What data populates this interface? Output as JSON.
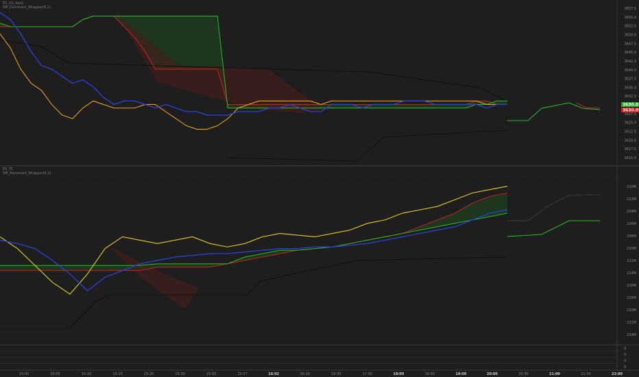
{
  "top_pane": {
    "title_line1": "ES_US_daily",
    "title_line2": "SM_Dominant_Wrapper(6,1)",
    "price_badges": [
      {
        "value": "3630.0",
        "color": "#1faa1f"
      },
      {
        "value": "3630.0",
        "color": "#e01010"
      }
    ]
  },
  "bottom_pane": {
    "title_line1": "ES_TC",
    "title_line2": "SM_Advanced_Wrapper(6,1)"
  },
  "colors": {
    "background": "#1e1e1e",
    "conversion_line": "#2b3fd1",
    "base_line": "#e6a020",
    "span_a": "#22c422",
    "span_b": "#cc2222",
    "lagging_span": "#111111",
    "cloud_bull": "#1d4a1d",
    "cloud_bear": "#4a1d1d"
  },
  "chart_data": [
    {
      "type": "line",
      "pane": "top",
      "y_ticks": [
        "3657.5",
        "3655.0",
        "3652.5",
        "3650.0",
        "3647.5",
        "3645.0",
        "3642.5",
        "3640.0",
        "3637.5",
        "3635.0",
        "3632.5",
        "3630.0",
        "3627.5",
        "3625.0",
        "3622.5",
        "3620.0",
        "3617.5",
        "3615.0"
      ],
      "ylim": [
        3614,
        3658
      ],
      "series": [
        {
          "role": "conversion",
          "values": [
            3656,
            3654,
            3650,
            3645,
            3641,
            3640,
            3638,
            3636,
            3637,
            3635,
            3632,
            3630,
            3631,
            3631,
            3630,
            3629,
            3630,
            3629,
            3628,
            3628,
            3627,
            3627,
            3627,
            3628,
            3628,
            3628,
            3629,
            3629,
            3630,
            3629,
            3628,
            3628,
            3630,
            3630,
            3630,
            3629,
            3630,
            3630,
            3630,
            3631,
            3631,
            3631,
            3630,
            3630,
            3630,
            3630,
            3630,
            3629,
            3630,
            3630
          ]
        },
        {
          "role": "base",
          "values": [
            3650,
            3646,
            3640,
            3636,
            3634,
            3630,
            3627,
            3626,
            3629,
            3631,
            3630,
            3629,
            3629,
            3629,
            3630,
            3630,
            3628,
            3626,
            3624,
            3623,
            3623,
            3624,
            3626,
            3629,
            3630,
            3631,
            3631,
            3631,
            3631,
            3631,
            3631,
            3630,
            3631,
            3631,
            3631,
            3631,
            3631,
            3631,
            3631,
            3631,
            3631,
            3631,
            3631,
            3631,
            3631,
            3631,
            3631,
            3630,
            3630,
            3630
          ]
        },
        {
          "role": "span_a",
          "values": [
            3653,
            3652,
            3652,
            3652,
            3652,
            3652,
            3652,
            3652,
            3654,
            3655,
            3655,
            3655,
            3655,
            3655,
            3655,
            3655,
            3655,
            3655,
            3655,
            3655,
            3655,
            3655,
            3629,
            3629,
            3629,
            3629,
            3629,
            3629,
            3629,
            3629,
            3629,
            3629,
            3629,
            3629,
            3629,
            3629,
            3629,
            3629,
            3629,
            3629,
            3629,
            3629,
            3629,
            3629,
            3629,
            3629,
            3630,
            3630,
            3631,
            3631
          ]
        },
        {
          "role": "span_b",
          "values": [
            3652,
            3652,
            3652,
            3652,
            3652,
            3652,
            3652,
            3652,
            3654,
            3655,
            3655,
            3655,
            3652,
            3649,
            3645,
            3640,
            3640,
            3640,
            3640,
            3640,
            3640,
            3640,
            3630,
            3630,
            3630,
            3630,
            3630,
            3630,
            3630,
            3630,
            3630,
            3630,
            3630,
            3630,
            3630,
            3630,
            3630,
            3630,
            3630,
            3630,
            3630,
            3630,
            3630,
            3630,
            3630,
            3630,
            3631,
            3631,
            3630,
            3630
          ]
        }
      ]
    },
    {
      "type": "line",
      "pane": "bottom",
      "y_ticks": [
        "210M",
        "212M",
        "204M",
        "206M",
        "208M",
        "210M",
        "212M",
        "214M",
        "216M",
        "218M",
        "220M",
        "222M",
        "224M"
      ],
      "series": [
        {
          "role": "conversion",
          "values": [
            0.6,
            0.58,
            0.55,
            0.48,
            0.4,
            0.3,
            0.38,
            0.42,
            0.46,
            0.48,
            0.5,
            0.51,
            0.52,
            0.52,
            0.53,
            0.54,
            0.55,
            0.55,
            0.56,
            0.56,
            0.57,
            0.58,
            0.6,
            0.62,
            0.64,
            0.66,
            0.68,
            0.72,
            0.76,
            0.78
          ]
        },
        {
          "role": "base",
          "values": [
            0.62,
            0.55,
            0.45,
            0.35,
            0.28,
            0.4,
            0.55,
            0.62,
            0.6,
            0.58,
            0.6,
            0.62,
            0.58,
            0.56,
            0.58,
            0.62,
            0.64,
            0.63,
            0.62,
            0.64,
            0.66,
            0.7,
            0.72,
            0.76,
            0.78,
            0.8,
            0.84,
            0.88,
            0.9,
            0.92
          ]
        },
        {
          "role": "span_a",
          "values": [
            0.45,
            0.45,
            0.45,
            0.45,
            0.45,
            0.45,
            0.45,
            0.45,
            0.45,
            0.46,
            0.46,
            0.46,
            0.46,
            0.46,
            0.5,
            0.52,
            0.54,
            0.54,
            0.55,
            0.56,
            0.58,
            0.6,
            0.62,
            0.64,
            0.66,
            0.68,
            0.7,
            0.72,
            0.74,
            0.76
          ]
        },
        {
          "role": "span_b",
          "values": [
            0.42,
            0.42,
            0.42,
            0.42,
            0.42,
            0.42,
            0.42,
            0.42,
            0.42,
            0.44,
            0.44,
            0.44,
            0.44,
            0.46,
            0.48,
            0.5,
            0.52,
            0.54,
            0.55,
            0.56,
            0.58,
            0.6,
            0.62,
            0.64,
            0.68,
            0.72,
            0.76,
            0.82,
            0.86,
            0.88
          ]
        }
      ]
    }
  ],
  "x_axis": {
    "labels": [
      {
        "text": "15:00",
        "bold": false
      },
      {
        "text": "15:05",
        "bold": false
      },
      {
        "text": "15:10",
        "bold": false
      },
      {
        "text": "15:15",
        "bold": false
      },
      {
        "text": "15:20",
        "bold": false
      },
      {
        "text": "15:30",
        "bold": false
      },
      {
        "text": "15:50",
        "bold": false
      },
      {
        "text": "15:57",
        "bold": false
      },
      {
        "text": "16:02",
        "bold": true
      },
      {
        "text": "16:10",
        "bold": false
      },
      {
        "text": "16:30",
        "bold": false
      },
      {
        "text": "17:00",
        "bold": false
      },
      {
        "text": "18:00",
        "bold": true
      },
      {
        "text": "18:30",
        "bold": false
      },
      {
        "text": "19:00",
        "bold": true
      },
      {
        "text": "20:00",
        "bold": true
      },
      {
        "text": "20:30",
        "bold": false
      },
      {
        "text": "21:00",
        "bold": true
      },
      {
        "text": "21:30",
        "bold": false
      },
      {
        "text": "22:00",
        "bold": true
      }
    ]
  },
  "footer_pane": {
    "y_ticks": [
      "0",
      "0",
      "0",
      "0"
    ]
  }
}
